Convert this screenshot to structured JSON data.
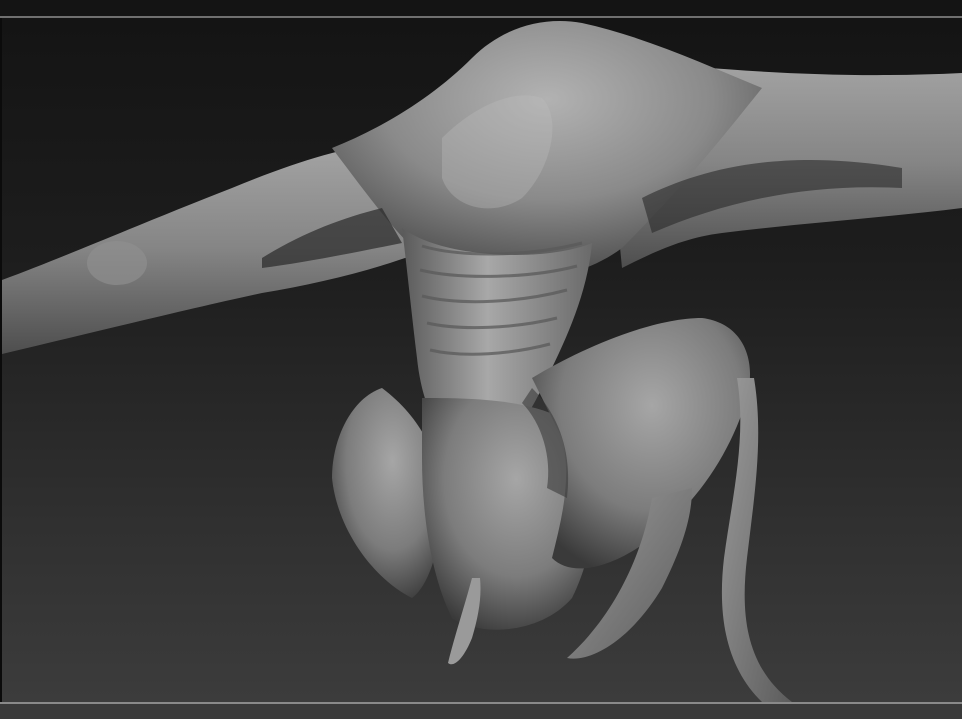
{
  "app": {
    "name": "",
    "viewport": {
      "subject": "sculpted-creature-mesh",
      "material": "matcap-gray",
      "background_top_color": "#141414",
      "background_bottom_color": "#3c3c3c",
      "mesh_color": "#8c8c8c",
      "frame_line_color": "#707070"
    }
  }
}
